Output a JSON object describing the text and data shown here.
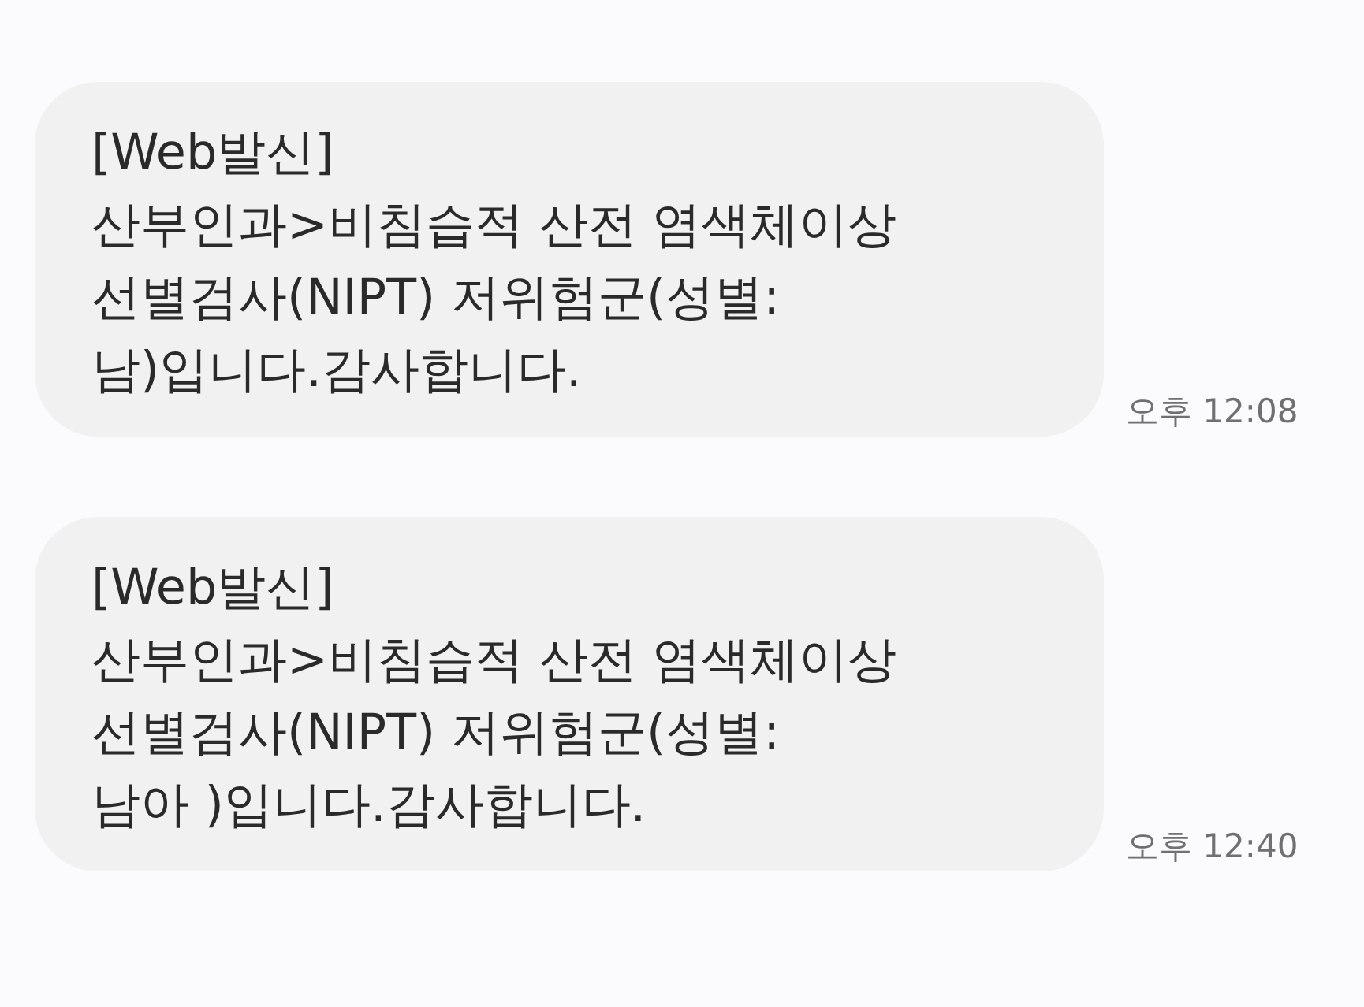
{
  "messages": [
    {
      "lines": [
        "[Web발신]",
        "산부인과>비침습적 산전 염색체이상",
        "선별검사(NIPT) 저위험군(성별:",
        "남)입니다.감사합니다."
      ],
      "time": "오후 12:08"
    },
    {
      "lines": [
        "[Web발신]",
        "산부인과>비침습적 산전 염색체이상",
        "선별검사(NIPT) 저위험군(성별:",
        "남아 )입니다.감사합니다."
      ],
      "time": "오후 12:40"
    }
  ]
}
